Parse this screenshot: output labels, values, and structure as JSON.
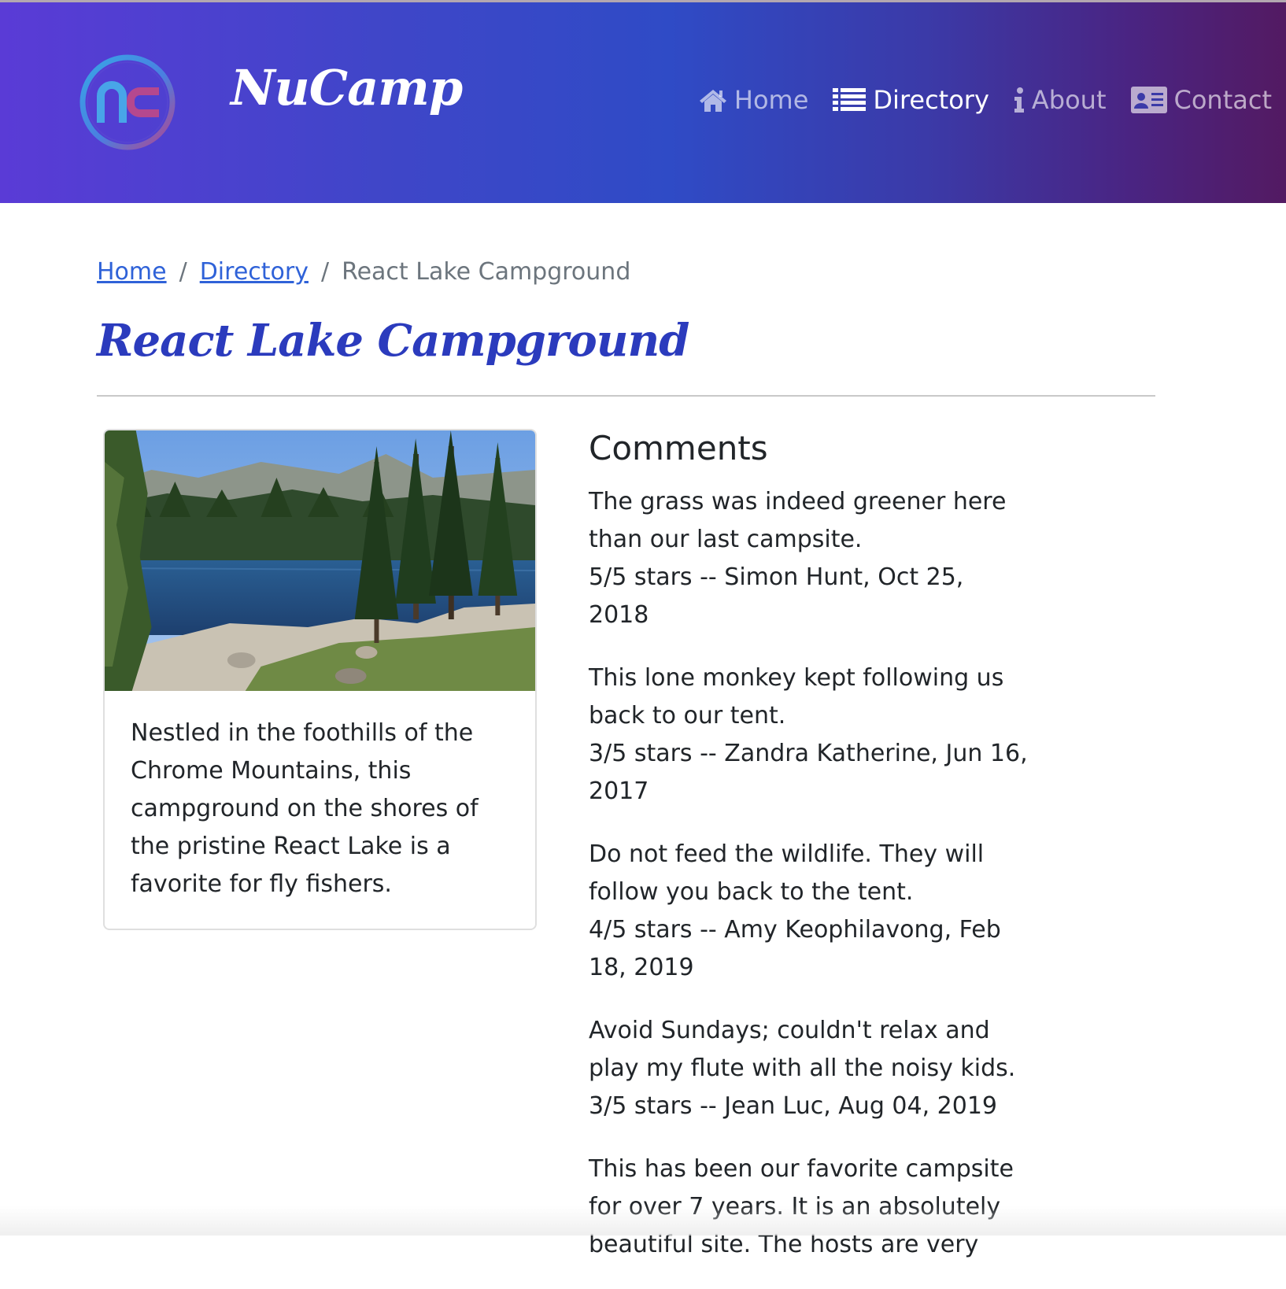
{
  "header": {
    "brand": "NuCamp",
    "logo_text": "nc",
    "colors": {
      "gradient_start": "#5a3bd6",
      "gradient_mid": "#2f4bc6",
      "gradient_end": "#531a62"
    },
    "nav": [
      {
        "label": "Home",
        "icon": "home-icon",
        "active": false
      },
      {
        "label": "Directory",
        "icon": "list-icon",
        "active": true
      },
      {
        "label": "About",
        "icon": "info-icon",
        "active": false
      },
      {
        "label": "Contact",
        "icon": "address-card-icon",
        "active": false
      }
    ]
  },
  "breadcrumb": {
    "items": [
      {
        "label": "Home",
        "link": true
      },
      {
        "label": "Directory",
        "link": true
      },
      {
        "label": "React Lake Campground",
        "link": false
      }
    ],
    "separator": "/"
  },
  "page": {
    "title": "React Lake Campground"
  },
  "campsite": {
    "description": "Nestled in the foothills of the Chrome Mountains, this campground on the shores of the pristine React Lake is a favorite for fly fishers."
  },
  "comments": {
    "heading": "Comments",
    "items": [
      {
        "text": "The grass was indeed greener here than our last campsite.",
        "meta": "5/5 stars -- Simon Hunt, Oct 25, 2018"
      },
      {
        "text": "This lone monkey kept following us back to our tent.",
        "meta": "3/5 stars -- Zandra Katherine, Jun 16, 2017"
      },
      {
        "text": "Do not feed the wildlife. They will follow you back to the tent.",
        "meta": "4/5 stars -- Amy Keophilavong, Feb 18, 2019"
      },
      {
        "text": "Avoid Sundays; couldn't relax and play my flute with all the noisy kids.",
        "meta": "3/5 stars -- Jean Luc, Aug 04, 2019"
      },
      {
        "text": "This has been our favorite campsite for over 7 years. It is an absolutely beautiful site. The hosts are very",
        "meta": ""
      }
    ]
  }
}
